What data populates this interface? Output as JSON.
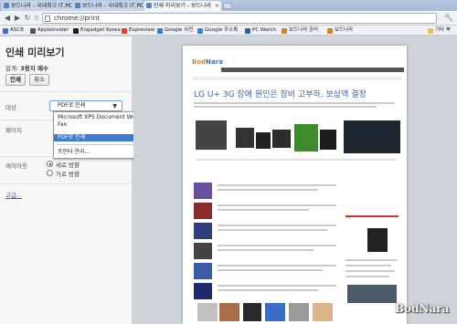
{
  "tabs": [
    {
      "label": "보드나라 - 국내최고 IT,PC"
    },
    {
      "label": "보드나라 - 국내최고 IT,PC"
    },
    {
      "label": "인쇄 미리보기 - 보드나라"
    }
  ],
  "address": {
    "url": "chrome://print"
  },
  "bookmarks": [
    {
      "label": "ASCB",
      "color": "#3b6cc7"
    },
    {
      "label": "AppleInsider",
      "color": "#555555"
    },
    {
      "label": "Engadget Korea",
      "color": "#1d1d1d"
    },
    {
      "label": "Expreview",
      "color": "#e0431b"
    },
    {
      "label": "Google 사전",
      "color": "#3a7be0"
    },
    {
      "label": "Google 주소록",
      "color": "#3a7be0"
    },
    {
      "label": "PC Watch",
      "color": "#2a5bb3"
    },
    {
      "label": "보드나라 관리",
      "color": "#d6822a"
    },
    {
      "label": "보드나라",
      "color": "#d6822a"
    },
    {
      "label": "기타 북",
      "color": "#e6c25a"
    }
  ],
  "print_panel": {
    "title": "인쇄 미리보기",
    "summary_prefix": "합계:",
    "summary_value": "3용지 매수",
    "print_button": "인쇄",
    "cancel_button": "취소",
    "destination_label": "대상",
    "destination_selected": "PDF로 인쇄",
    "dropdown_options": [
      {
        "label": "Microsoft XPS Document Writer"
      },
      {
        "label": "Fax"
      },
      {
        "label": "PDF로 인쇄",
        "selected": true
      },
      {
        "label": "프린터 관리..."
      }
    ],
    "pages_label": "페이지",
    "layout_label": "레이아웃",
    "portrait_label": "세로 방향",
    "landscape_label": "가로 방향",
    "orientation_selected": "portrait",
    "advanced_link": "고급..."
  },
  "preview": {
    "logo_primary": "Bod",
    "logo_secondary": "Nara",
    "headline": "LG U+ 3G 장애 원인은 장비 고부하, 보상액 결정"
  },
  "watermark": "BodNara"
}
